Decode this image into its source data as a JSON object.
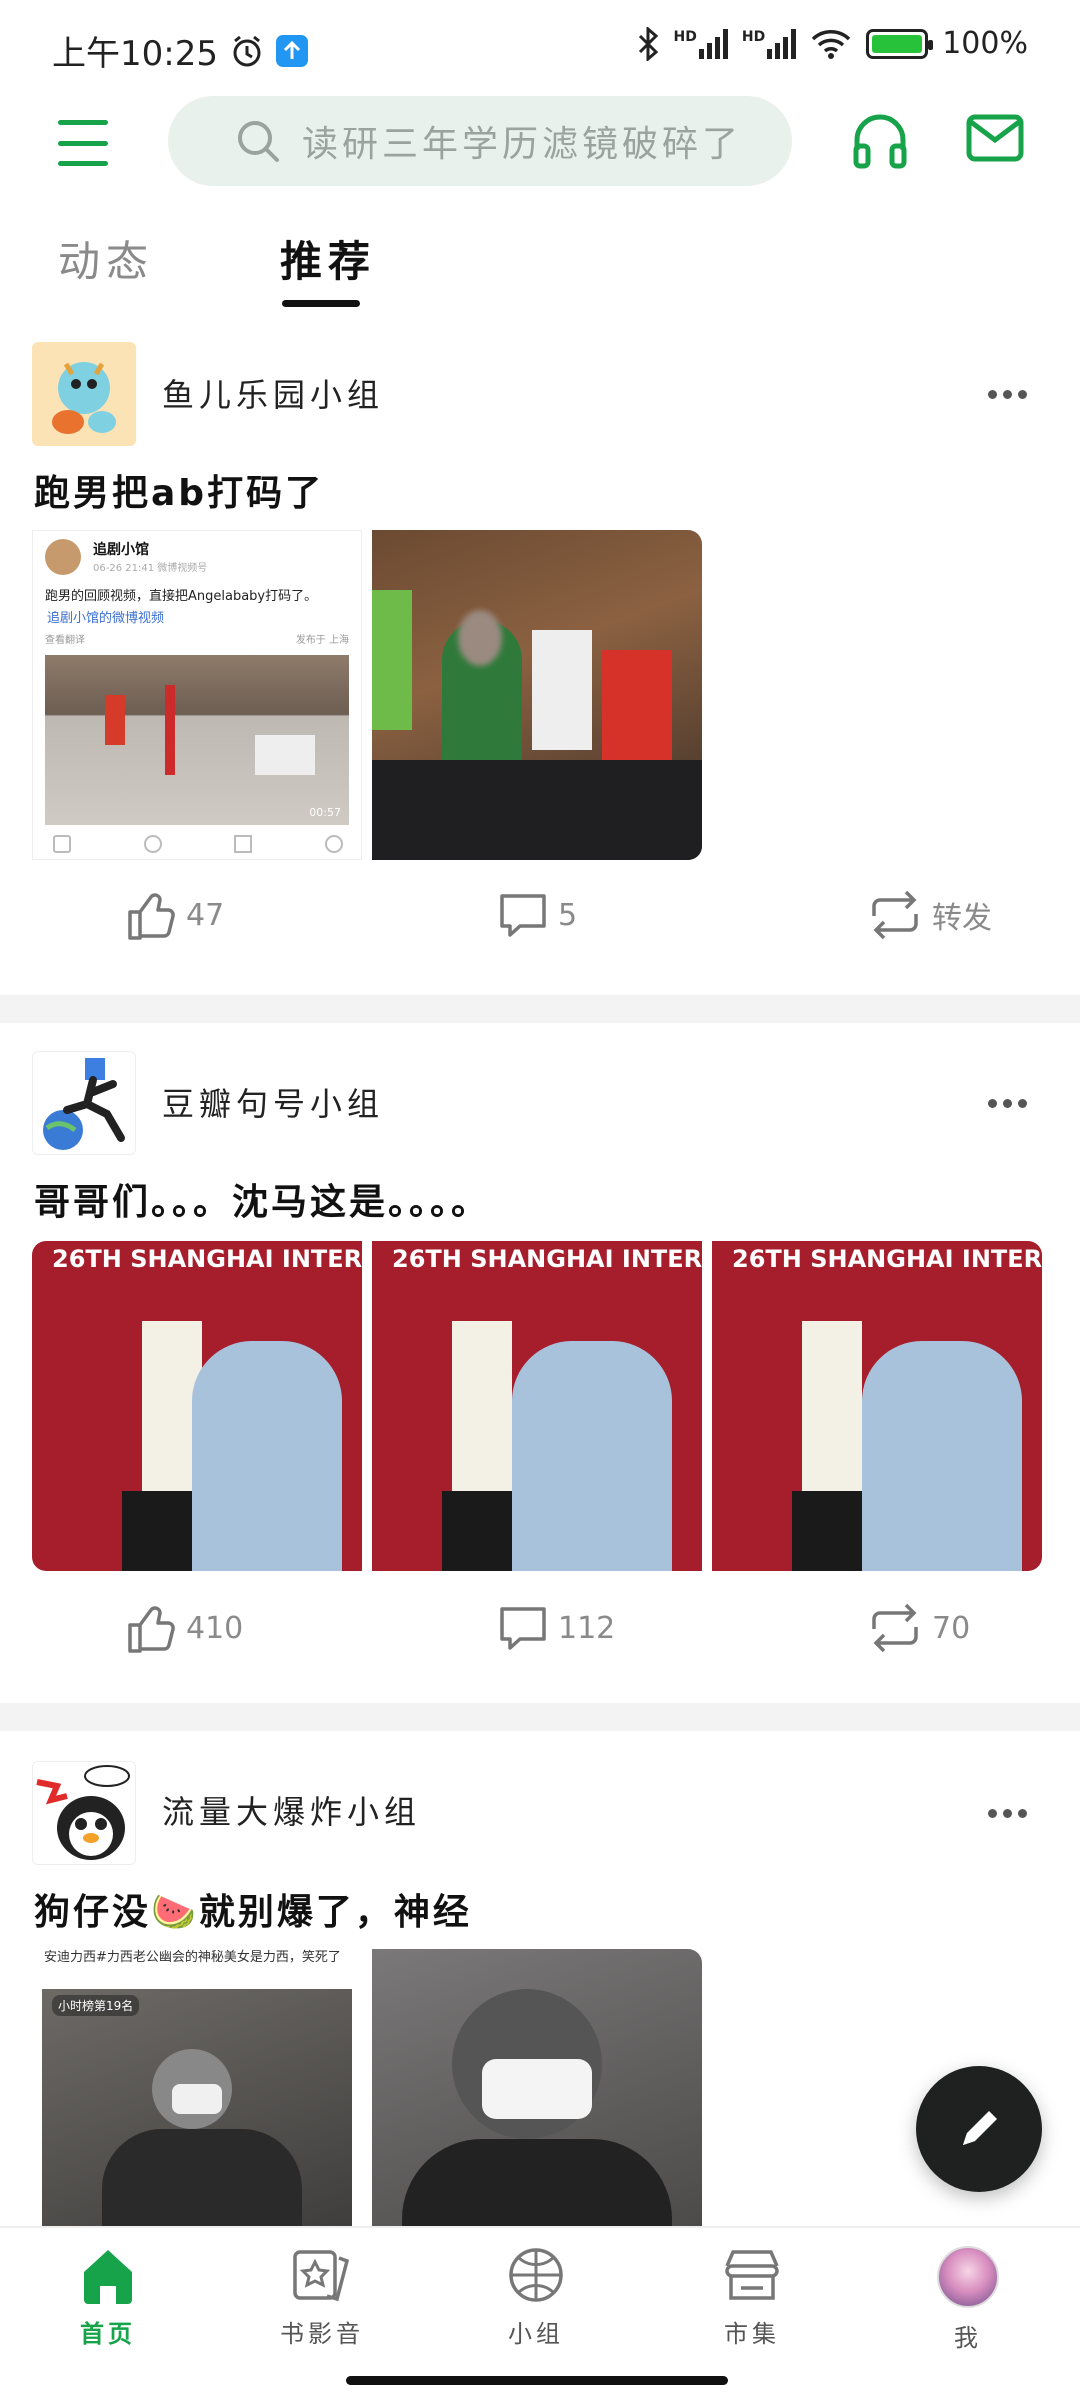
{
  "status": {
    "time": "上午10:25",
    "battery_text": "100%",
    "battery_level": 1.0,
    "network_tags": [
      "HD",
      "HD"
    ]
  },
  "topbar": {
    "search_placeholder": "读研三年学历滤镜破碎了",
    "accent_color": "#16a34a"
  },
  "tabs": [
    {
      "label": "动态",
      "active": false
    },
    {
      "label": "推荐",
      "active": true
    }
  ],
  "posts": [
    {
      "group": "鱼儿乐园小组",
      "title": "跑男把ab打码了",
      "embedded_post": {
        "user": "追剧小馆",
        "time": "06-26 21:41 微博视频号",
        "text": "跑男的回顾视频，直接把Angelababy打码了。",
        "link": "追剧小馆的微博视频",
        "footer_left": "查看翻译",
        "footer_right": "发布于 上海",
        "video_time": "00:57"
      },
      "likes": "47",
      "comments": "5",
      "reposts": "转发"
    },
    {
      "group": "豆瓣句号小组",
      "title": "哥哥们。。。沈马这是。。。。",
      "banner_text": "26TH SHANGHAI INTER",
      "likes": "410",
      "comments": "112",
      "reposts": "70"
    },
    {
      "group": "流量大爆炸小组",
      "title": "狗仔没🍉就别爆了，神经",
      "caption": "安迪力西#力西老公幽会的神秘美女是力西，笑死了",
      "badge": "小时榜第19名"
    }
  ],
  "bottom_nav": [
    {
      "label": "首页",
      "icon": "home-icon",
      "active": true
    },
    {
      "label": "书影音",
      "icon": "star-book-icon",
      "active": false
    },
    {
      "label": "小组",
      "icon": "group-ball-icon",
      "active": false
    },
    {
      "label": "市集",
      "icon": "store-icon",
      "active": false
    },
    {
      "label": "我",
      "icon": "avatar",
      "active": false
    }
  ]
}
